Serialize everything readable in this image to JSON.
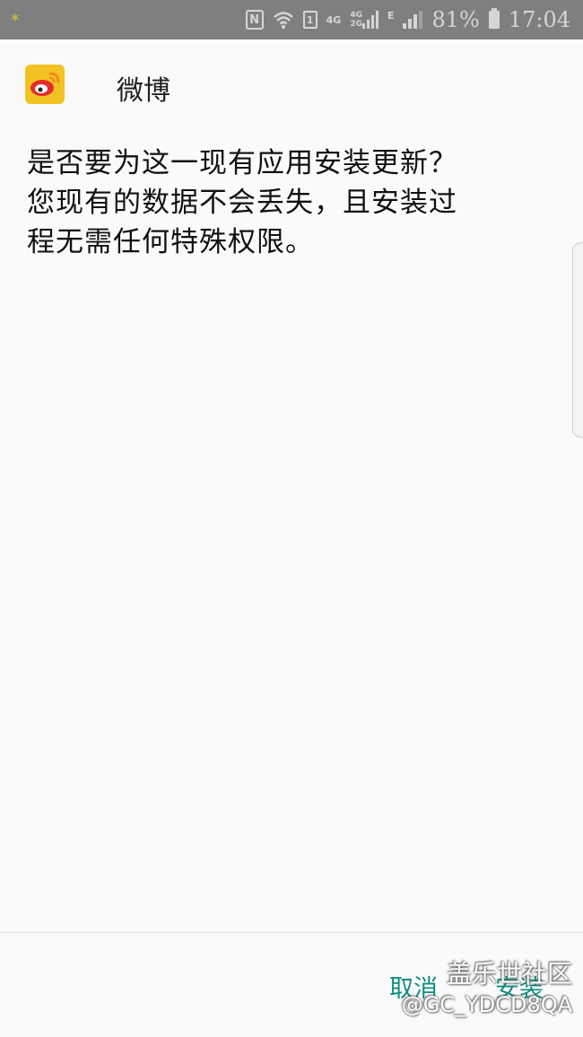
{
  "status_bar": {
    "nfc": "N",
    "sim": "1",
    "net_4g": "4G",
    "net_4g_small": "4G",
    "net_2g_small": "2G",
    "net_e": "E",
    "battery": "81%",
    "time": "17:04"
  },
  "header": {
    "app_name": "微博",
    "icon": "weibo-logo-icon"
  },
  "message": {
    "line1": "是否要为这一现有应用安装更新？",
    "line2": "您现有的数据不会丢失，且安装过",
    "line3": "程无需任何特殊权限。"
  },
  "actions": {
    "cancel": "取消",
    "install": "安装"
  },
  "watermark": {
    "site": "盖乐世社区",
    "user": "@GC_YDCD8QA"
  },
  "colors": {
    "accent": "#0f8c80",
    "status_bar": "#7f7f7f",
    "icon_bg": "#f2c224"
  }
}
